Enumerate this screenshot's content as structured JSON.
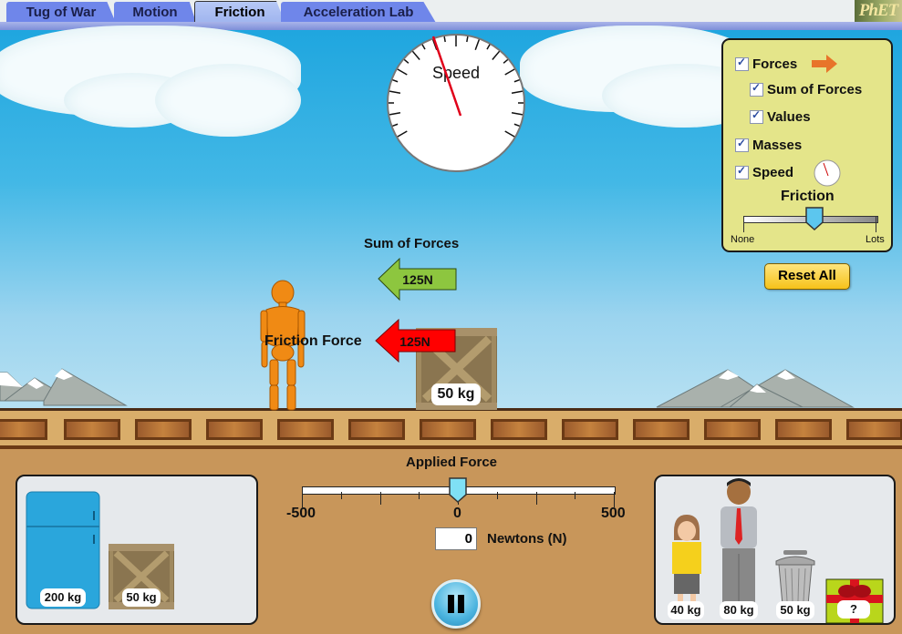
{
  "tabs": [
    {
      "label": "Tug of War",
      "active": false
    },
    {
      "label": "Motion",
      "active": false
    },
    {
      "label": "Friction",
      "active": true
    },
    {
      "label": "Acceleration Lab",
      "active": false
    }
  ],
  "logo": "PhET",
  "speedometer": {
    "label": "Speed"
  },
  "control_panel": {
    "forces": {
      "label": "Forces",
      "checked": true
    },
    "sum_of_forces": {
      "label": "Sum of Forces",
      "checked": true
    },
    "values": {
      "label": "Values",
      "checked": true
    },
    "masses": {
      "label": "Masses",
      "checked": true
    },
    "speed": {
      "label": "Speed",
      "checked": true
    },
    "friction": {
      "label": "Friction",
      "min_label": "None",
      "max_label": "Lots",
      "value_fraction": 0.5
    },
    "reset_label": "Reset All"
  },
  "scene": {
    "sum_of_forces_label": "Sum of Forces",
    "sum_of_forces_value": "125N",
    "friction_force_label": "Friction Force",
    "friction_force_value": "125N",
    "crate_mass": "50 kg"
  },
  "applied_force": {
    "title": "Applied Force",
    "min_label": "-500",
    "mid_label": "0",
    "max_label": "500",
    "value": "0",
    "unit_label": "Newtons (N)"
  },
  "left_shelf": [
    {
      "name": "refrigerator",
      "mass": "200 kg"
    },
    {
      "name": "crate",
      "mass": "50 kg"
    }
  ],
  "right_shelf": [
    {
      "name": "girl",
      "mass": "40 kg"
    },
    {
      "name": "man",
      "mass": "80 kg"
    },
    {
      "name": "trash-can",
      "mass": "50 kg"
    },
    {
      "name": "mystery-gift",
      "mass": "?"
    }
  ],
  "colors": {
    "sum_arrow": "#8dc63f",
    "friction_arrow": "#ff0000",
    "force_indicator": "#e8742a",
    "panel_bg": "#e4e58a",
    "reset_button": "#f6c21a"
  }
}
